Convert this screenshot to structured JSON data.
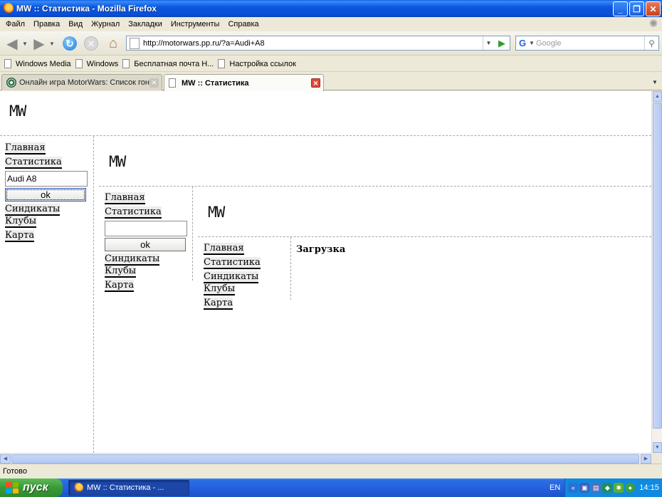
{
  "window": {
    "title": "MW :: Статистика - Mozilla Firefox"
  },
  "menu": [
    "Файл",
    "Правка",
    "Вид",
    "Журнал",
    "Закладки",
    "Инструменты",
    "Справка"
  ],
  "toolbar": {
    "url": "http://motorwars.pp.ru/?a=Audi+A8",
    "search_placeholder": "Google",
    "search_engine_letter": "G"
  },
  "bookmarks": [
    "Windows Media",
    "Windows",
    "Бесплатная почта Н...",
    "Настройка ссылок"
  ],
  "tabs": [
    {
      "label": "Онлайн игра MotorWars: Список гон...",
      "active": false
    },
    {
      "label": "MW :: Статистика",
      "active": true
    }
  ],
  "page": {
    "logo": "MW",
    "nav": {
      "home": "Главная",
      "stats": "Статистика",
      "syndicates": "Синдикаты",
      "clubs": "Клубы",
      "map": "Карта",
      "ok": "ok"
    },
    "level1_input_value": "Audi A8",
    "level2_input_value": "",
    "loading": "Загрузка"
  },
  "status": {
    "text": "Готово"
  },
  "taskbar": {
    "start": "пуск",
    "item": "MW :: Статистика - ...",
    "lang": "EN",
    "clock": "14:15"
  }
}
